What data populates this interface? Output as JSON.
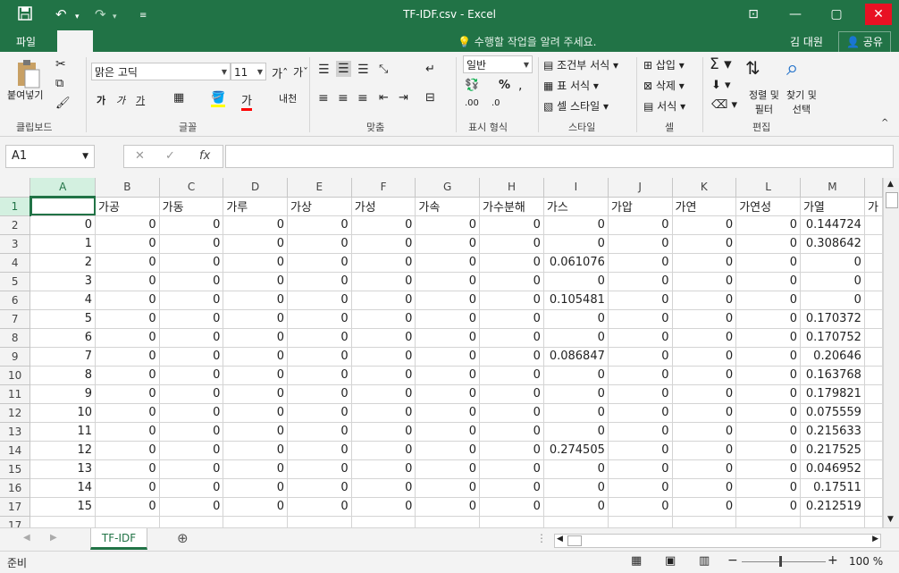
{
  "window": {
    "title": "TF-IDF.csv - Excel",
    "user": "김 대원",
    "share": "공유",
    "tell_me": "수행할 작업을 알려 주세요."
  },
  "ribbon": {
    "file_tab": "파일",
    "clipboard": {
      "paste": "붙여넣기",
      "label": "클립보드"
    },
    "font": {
      "name": "맑은 고딕",
      "size": "11",
      "bold": "가",
      "italic": "가",
      "underline": "가",
      "label": "글꼴"
    },
    "alignment": {
      "label": "맞춤"
    },
    "number": {
      "format": "일반",
      "percent": "%",
      "label": "표시 형식"
    },
    "styles": {
      "conditional": "조건부 서식",
      "table": "표 서식",
      "cell": "셀 스타일",
      "label": "스타일"
    },
    "cells": {
      "insert": "삽입",
      "delete": "삭제",
      "format": "서식",
      "label": "셀"
    },
    "editing": {
      "sort": "정렬 및",
      "sort2": "필터",
      "find": "찾기 및",
      "find2": "선택",
      "label": "편집"
    }
  },
  "formula_bar": {
    "name_box": "A1",
    "fx": "fx",
    "formula": ""
  },
  "sheet": {
    "columns": [
      "A",
      "B",
      "C",
      "D",
      "E",
      "F",
      "G",
      "H",
      "I",
      "J",
      "K",
      "L",
      "M"
    ],
    "header_row": [
      "",
      "가공",
      "가동",
      "가루",
      "가상",
      "가성",
      "가속",
      "가수분해",
      "가스",
      "가압",
      "가연",
      "가연성",
      "가열"
    ],
    "rows": [
      [
        "0",
        "0",
        "0",
        "0",
        "0",
        "0",
        "0",
        "0",
        "0",
        "0",
        "0",
        "0",
        "0.144724"
      ],
      [
        "1",
        "0",
        "0",
        "0",
        "0",
        "0",
        "0",
        "0",
        "0",
        "0",
        "0",
        "0",
        "0.308642"
      ],
      [
        "2",
        "0",
        "0",
        "0",
        "0",
        "0",
        "0",
        "0",
        "0.061076",
        "0",
        "0",
        "0",
        "0"
      ],
      [
        "3",
        "0",
        "0",
        "0",
        "0",
        "0",
        "0",
        "0",
        "0",
        "0",
        "0",
        "0",
        "0"
      ],
      [
        "4",
        "0",
        "0",
        "0",
        "0",
        "0",
        "0",
        "0",
        "0.105481",
        "0",
        "0",
        "0",
        "0"
      ],
      [
        "5",
        "0",
        "0",
        "0",
        "0",
        "0",
        "0",
        "0",
        "0",
        "0",
        "0",
        "0",
        "0.170372"
      ],
      [
        "6",
        "0",
        "0",
        "0",
        "0",
        "0",
        "0",
        "0",
        "0",
        "0",
        "0",
        "0",
        "0.170752"
      ],
      [
        "7",
        "0",
        "0",
        "0",
        "0",
        "0",
        "0",
        "0",
        "0.086847",
        "0",
        "0",
        "0",
        "0.20646"
      ],
      [
        "8",
        "0",
        "0",
        "0",
        "0",
        "0",
        "0",
        "0",
        "0",
        "0",
        "0",
        "0",
        "0.163768"
      ],
      [
        "9",
        "0",
        "0",
        "0",
        "0",
        "0",
        "0",
        "0",
        "0",
        "0",
        "0",
        "0",
        "0.179821"
      ],
      [
        "10",
        "0",
        "0",
        "0",
        "0",
        "0",
        "0",
        "0",
        "0",
        "0",
        "0",
        "0",
        "0.075559"
      ],
      [
        "11",
        "0",
        "0",
        "0",
        "0",
        "0",
        "0",
        "0",
        "0",
        "0",
        "0",
        "0",
        "0.215633"
      ],
      [
        "12",
        "0",
        "0",
        "0",
        "0",
        "0",
        "0",
        "0",
        "0.274505",
        "0",
        "0",
        "0",
        "0.217525"
      ],
      [
        "13",
        "0",
        "0",
        "0",
        "0",
        "0",
        "0",
        "0",
        "0",
        "0",
        "0",
        "0",
        "0.046952"
      ],
      [
        "14",
        "0",
        "0",
        "0",
        "0",
        "0",
        "0",
        "0",
        "0",
        "0",
        "0",
        "0",
        "0.17511"
      ],
      [
        "15",
        "0",
        "0",
        "0",
        "0",
        "0",
        "0",
        "0",
        "0",
        "0",
        "0",
        "0",
        "0.212519"
      ]
    ],
    "row_numbers": [
      "1",
      "2",
      "3",
      "4",
      "5",
      "6",
      "7",
      "8",
      "9",
      "10",
      "11",
      "12",
      "13",
      "14",
      "15",
      "16",
      "17"
    ],
    "sheet_tab": "TF-IDF",
    "partial_col_text": "가"
  },
  "status": {
    "ready": "준비",
    "zoom": "100 %"
  },
  "colors": {
    "brand": "#217346",
    "active": "#217346"
  }
}
